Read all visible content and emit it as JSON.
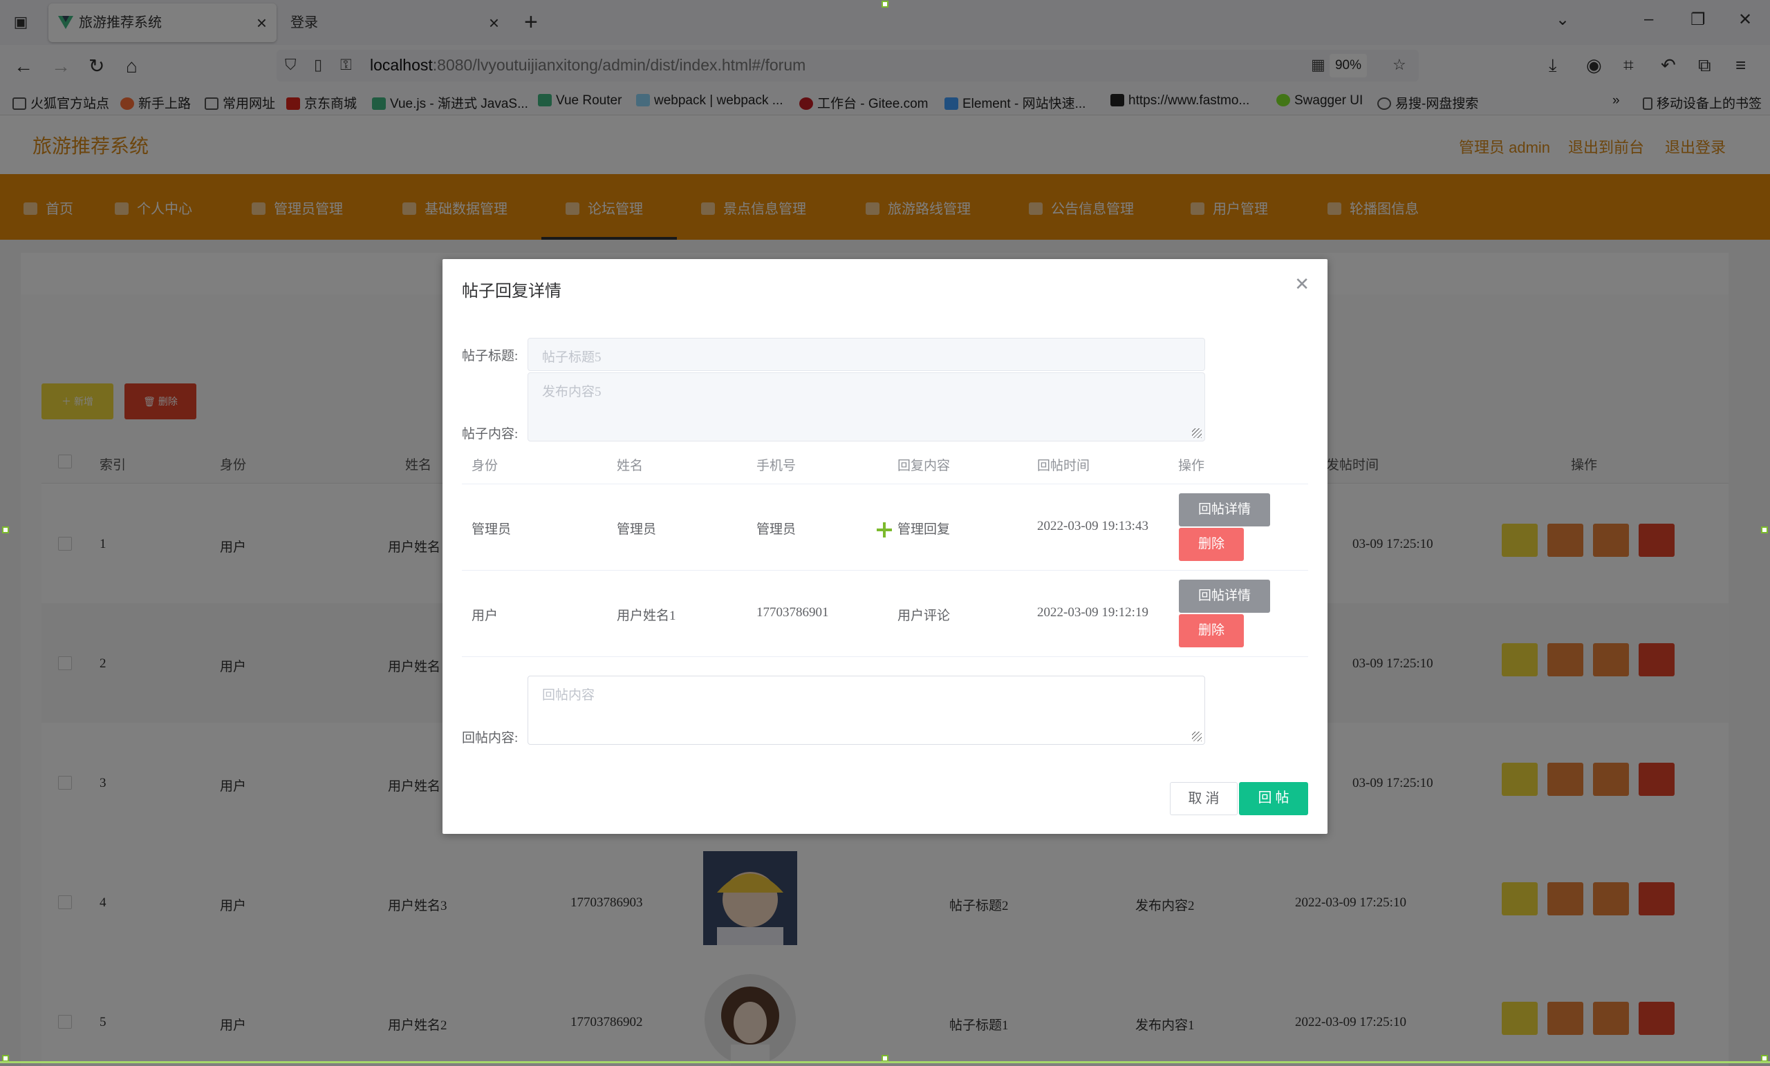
{
  "browser": {
    "tabs": [
      {
        "label": "旅游推荐系统",
        "active": true
      },
      {
        "label": "登录",
        "active": false
      }
    ],
    "url_host": "localhost",
    "url_rest": ":8080/lvyoutuijianxitong/admin/dist/index.html#/forum",
    "zoom": "90%",
    "bookmarks": [
      {
        "label": "火狐官方站点",
        "icon": "folder-icon",
        "color": "#555555"
      },
      {
        "label": "新手上路",
        "icon": "firefox-icon",
        "color": "#ff7139"
      },
      {
        "label": "常用网址",
        "icon": "folder-icon",
        "color": "#555555"
      },
      {
        "label": "京东商城",
        "icon": "jd-icon",
        "color": "#e1251b"
      },
      {
        "label": "Vue.js - 渐进式 JavaS...",
        "icon": "vue-icon",
        "color": "#41b883"
      },
      {
        "label": "Vue Router",
        "icon": "vue-icon",
        "color": "#41b883"
      },
      {
        "label": "webpack | webpack ...",
        "icon": "webpack-icon",
        "color": "#8ed6fb"
      },
      {
        "label": "工作台 - Gitee.com",
        "icon": "gitee-icon",
        "color": "#c71d23"
      },
      {
        "label": "Element - 网站快速...",
        "icon": "element-icon",
        "color": "#409eff"
      },
      {
        "label": "https://www.fastmo...",
        "icon": "fastmock-icon",
        "color": "#222222"
      },
      {
        "label": "Swagger UI",
        "icon": "swagger-icon",
        "color": "#85ea2d"
      },
      {
        "label": "易搜-网盘搜索",
        "icon": "globe-icon",
        "color": "#555555"
      }
    ],
    "mobile_bookmarks": "移动设备上的书签"
  },
  "app": {
    "title": "旅游推荐系统",
    "header_links": [
      "管理员 admin",
      "退出到前台",
      "退出登录"
    ],
    "menu": [
      "首页",
      "个人中心",
      "管理员管理",
      "基础数据管理",
      "论坛管理",
      "景点信息管理",
      "旅游路线管理",
      "公告信息管理",
      "用户管理",
      "轮播图信息"
    ],
    "active_menu": "论坛管理",
    "add_button": "新增",
    "delete_button": "删除",
    "table_headers": [
      "索引",
      "身份",
      "姓名",
      "发帖时间",
      "操作"
    ],
    "rows": [
      {
        "index": "1",
        "role": "用户",
        "name": "用户姓名",
        "phone": "",
        "title": "",
        "content": "",
        "time": "03-09 17:25:10"
      },
      {
        "index": "2",
        "role": "用户",
        "name": "用户姓名",
        "phone": "",
        "title": "",
        "content": "",
        "time": "03-09 17:25:10"
      },
      {
        "index": "3",
        "role": "用户",
        "name": "用户姓名",
        "phone": "",
        "title": "",
        "content": "",
        "time": "03-09 17:25:10"
      },
      {
        "index": "4",
        "role": "用户",
        "name": "用户姓名3",
        "phone": "17703786903",
        "title": "帖子标题2",
        "content": "发布内容2",
        "time": "2022-03-09 17:25:10"
      },
      {
        "index": "5",
        "role": "用户",
        "name": "用户姓名2",
        "phone": "17703786902",
        "title": "帖子标题1",
        "content": "发布内容1",
        "time": "2022-03-09 17:25:10"
      }
    ],
    "row_action_colors": [
      "#f0d83c",
      "#e8823a",
      "#e8823a",
      "#e2452b"
    ]
  },
  "dialog": {
    "title": "帖子回复详情",
    "title_label": "帖子标题:",
    "title_value": "帖子标题5",
    "content_label": "帖子内容:",
    "content_value": "发布内容5",
    "reply_headers": [
      "身份",
      "姓名",
      "手机号",
      "回复内容",
      "回帖时间",
      "操作"
    ],
    "replies": [
      {
        "role": "管理员",
        "name": "管理员",
        "phone": "管理员",
        "content": "管理回复",
        "time": "2022-03-09 19:13:43"
      },
      {
        "role": "用户",
        "name": "用户姓名1",
        "phone": "17703786901",
        "content": "用户评论",
        "time": "2022-03-09 19:12:19"
      }
    ],
    "detail_button": "回帖详情",
    "delete_button": "删除",
    "reply_label": "回帖内容:",
    "reply_placeholder": "回帖内容",
    "cancel": "取 消",
    "submit": "回 帖"
  }
}
